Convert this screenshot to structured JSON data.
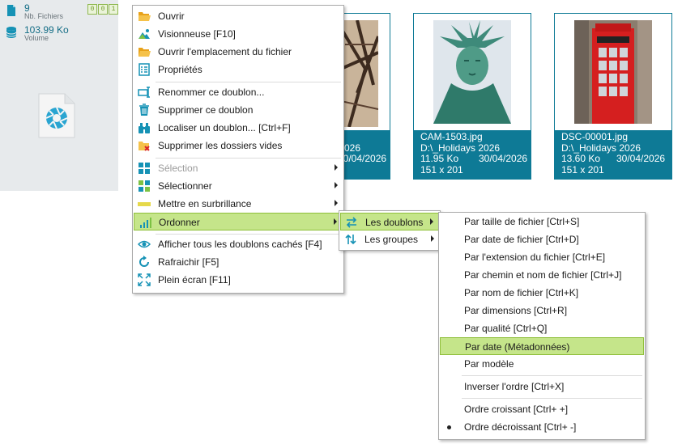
{
  "stats": {
    "files_count": "9",
    "files_label": "Nb. Fichiers",
    "size_value": "103.99 Ko",
    "size_label": "Volume",
    "badge_digits": [
      "0",
      "0",
      "1"
    ]
  },
  "thumbnails": [
    {
      "name": "",
      "path": "026",
      "size": "",
      "date": "30/04/2026",
      "dims": ""
    },
    {
      "name": "CAM-1503.jpg",
      "path": "D:\\_Holidays 2026",
      "size": "11.95 Ko",
      "date": "30/04/2026",
      "dims": "151 x 201"
    },
    {
      "name": "DSC-00001.jpg",
      "path": "D:\\_Holidays 2026",
      "size": "13.60 Ko",
      "date": "30/04/2026",
      "dims": "151 x 201"
    }
  ],
  "context_menu": {
    "items": [
      {
        "label": "Ouvrir",
        "icon": "folder-open-icon"
      },
      {
        "label": "Visionneuse  [F10]",
        "icon": "image-viewer-icon"
      },
      {
        "label": "Ouvrir l'emplacement du fichier",
        "icon": "folder-location-icon"
      },
      {
        "label": "Propriétés",
        "icon": "properties-icon"
      },
      {
        "label": "Renommer ce doublon...",
        "icon": "rename-icon"
      },
      {
        "label": "Supprimer ce doublon",
        "icon": "trash-icon"
      },
      {
        "label": "Localiser un doublon...  [Ctrl+F]",
        "icon": "binoculars-icon"
      },
      {
        "label": "Supprimer les dossiers vides",
        "icon": "delete-folder-icon"
      },
      {
        "label": "Sélection",
        "icon": "grid-icon"
      },
      {
        "label": "Sélectionner",
        "icon": "select-grid-icon"
      },
      {
        "label": "Mettre en surbrillance",
        "icon": "highlight-icon"
      },
      {
        "label": "Ordonner",
        "icon": "bar-chart-icon"
      },
      {
        "label": "Afficher tous les doublons cachés  [F4]",
        "icon": "eye-icon"
      },
      {
        "label": "Rafraichir  [F5]",
        "icon": "refresh-icon"
      },
      {
        "label": "Plein écran  [F11]",
        "icon": "fullscreen-icon"
      }
    ]
  },
  "submenu": {
    "items": [
      {
        "label": "Les doublons",
        "icon": "swap-horizontal-icon"
      },
      {
        "label": "Les groupes",
        "icon": "swap-vertical-icon"
      }
    ]
  },
  "sort_menu": {
    "items": [
      {
        "label": "Par taille de fichier  [Ctrl+S]"
      },
      {
        "label": "Par date de fichier  [Ctrl+D]"
      },
      {
        "label": "Par l'extension du fichier  [Ctrl+E]"
      },
      {
        "label": "Par chemin et nom de fichier  [Ctrl+J]"
      },
      {
        "label": "Par nom de fichier  [Ctrl+K]"
      },
      {
        "label": "Par dimensions  [Ctrl+R]"
      },
      {
        "label": "Par qualité  [Ctrl+Q]"
      },
      {
        "label": "Par date (Métadonnées)"
      },
      {
        "label": "Par modèle"
      },
      {
        "label": "Inverser l'ordre  [Ctrl+X]"
      },
      {
        "label": "Ordre croissant  [Ctrl+ +]"
      },
      {
        "label": "Ordre décroissant  [Ctrl+ -]"
      }
    ]
  },
  "colors": {
    "accent": "#0e7a96",
    "highlight": "#c5e58a",
    "highlight_border": "#8fbf3a"
  }
}
